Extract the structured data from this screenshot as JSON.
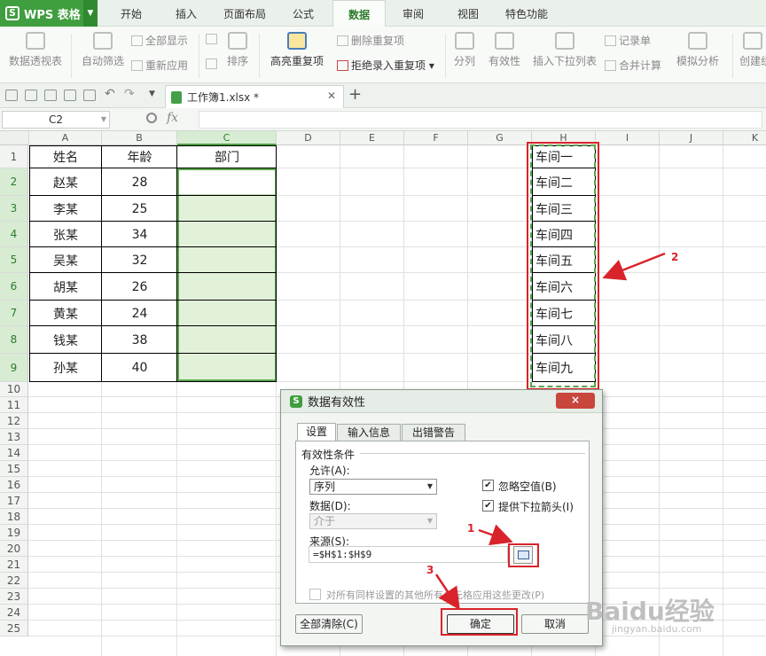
{
  "app": {
    "title": "WPS 表格"
  },
  "menu": {
    "tabs": [
      "开始",
      "插入",
      "页面布局",
      "公式",
      "数据",
      "审阅",
      "视图",
      "特色功能"
    ],
    "active": "数据"
  },
  "ribbon": {
    "pivot": "数据透视表",
    "autofilter": "自动筛选",
    "show_all": "全部显示",
    "reapply": "重新应用",
    "sort": "排序",
    "highlight_dup": "高亮重复项",
    "delete_dup": "删除重复项",
    "reject_dup": "拒绝录入重复项",
    "split": "分列",
    "validity": "有效性",
    "insert_dropdown": "插入下拉列表",
    "record": "记录单",
    "merge_calc": "合并计算",
    "simulate": "模拟分析",
    "create_group": "创建组"
  },
  "document": {
    "tab_name": "工作簿1.xlsx *"
  },
  "formula_bar": {
    "name_box": "C2",
    "fx": "fx"
  },
  "sheet": {
    "columns": [
      "A",
      "B",
      "C",
      "D",
      "E",
      "F",
      "G",
      "H",
      "I",
      "J",
      "K"
    ],
    "rows": [
      "1",
      "2",
      "3",
      "4",
      "5",
      "6",
      "7",
      "8",
      "9",
      "10",
      "11",
      "12",
      "13",
      "14",
      "15",
      "16",
      "17",
      "18",
      "19",
      "20",
      "21",
      "22",
      "23",
      "24",
      "25"
    ],
    "header_row": [
      "姓名",
      "年龄",
      "部门"
    ],
    "data": [
      [
        "赵某",
        "28"
      ],
      [
        "李某",
        "25"
      ],
      [
        "张某",
        "34"
      ],
      [
        "吴某",
        "32"
      ],
      [
        "胡某",
        "26"
      ],
      [
        "黄某",
        "24"
      ],
      [
        "钱某",
        "38"
      ],
      [
        "孙某",
        "40"
      ]
    ],
    "h_values": [
      "车间一",
      "车间二",
      "车间三",
      "车间四",
      "车间五",
      "车间六",
      "车间七",
      "车间八",
      "车间九"
    ]
  },
  "dialog": {
    "title": "数据有效性",
    "tabs": [
      "设置",
      "输入信息",
      "出错警告"
    ],
    "section": "有效性条件",
    "allow_label": "允许(A):",
    "allow_value": "序列",
    "data_label": "数据(D):",
    "data_value": "介于",
    "ignore_blank": "忽略空值(B)",
    "dropdown_arrow": "提供下拉箭头(I)",
    "source_label": "来源(S):",
    "source_value": "=$H$1:$H$9",
    "apply_all": "对所有同样设置的其他所有单元格应用这些更改(P)",
    "clear_all": "全部清除(C)",
    "ok": "确定",
    "cancel": "取消",
    "close": "×"
  },
  "annotations": {
    "n1": "1",
    "n2": "2",
    "n3": "3"
  },
  "watermark": {
    "brand": "Baidu经验",
    "url": "jingyan.baidu.com"
  }
}
